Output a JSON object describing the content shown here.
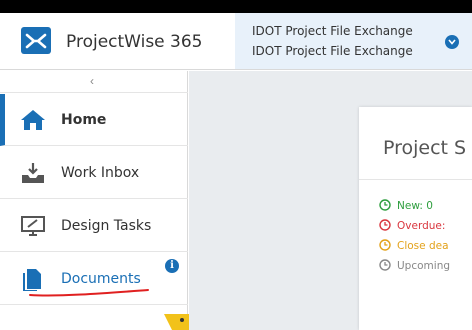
{
  "header": {
    "app_name": "ProjectWise 365",
    "project_line1": "IDOT Project File Exchange",
    "project_line2": "IDOT Project File Exchange"
  },
  "sidebar": {
    "collapse_glyph": "‹",
    "items": [
      {
        "label": "Home",
        "icon": "home-icon",
        "active": true
      },
      {
        "label": "Work Inbox",
        "icon": "inbox-icon"
      },
      {
        "label": "Design Tasks",
        "icon": "monitor-icon"
      },
      {
        "label": "Documents",
        "icon": "document-icon",
        "badge": "i"
      }
    ]
  },
  "main": {
    "card_title": "Project S",
    "stats": [
      {
        "label": "New: 0",
        "color": "#2e9e3e"
      },
      {
        "label": "Overdue:",
        "color": "#d9363e"
      },
      {
        "label": "Close dea",
        "color": "#e3a21a"
      },
      {
        "label": "Upcoming",
        "color": "#888888"
      }
    ]
  },
  "colors": {
    "accent": "#1a6fb5",
    "project_bg": "#e8f1fa",
    "main_bg": "#e9ecef"
  }
}
